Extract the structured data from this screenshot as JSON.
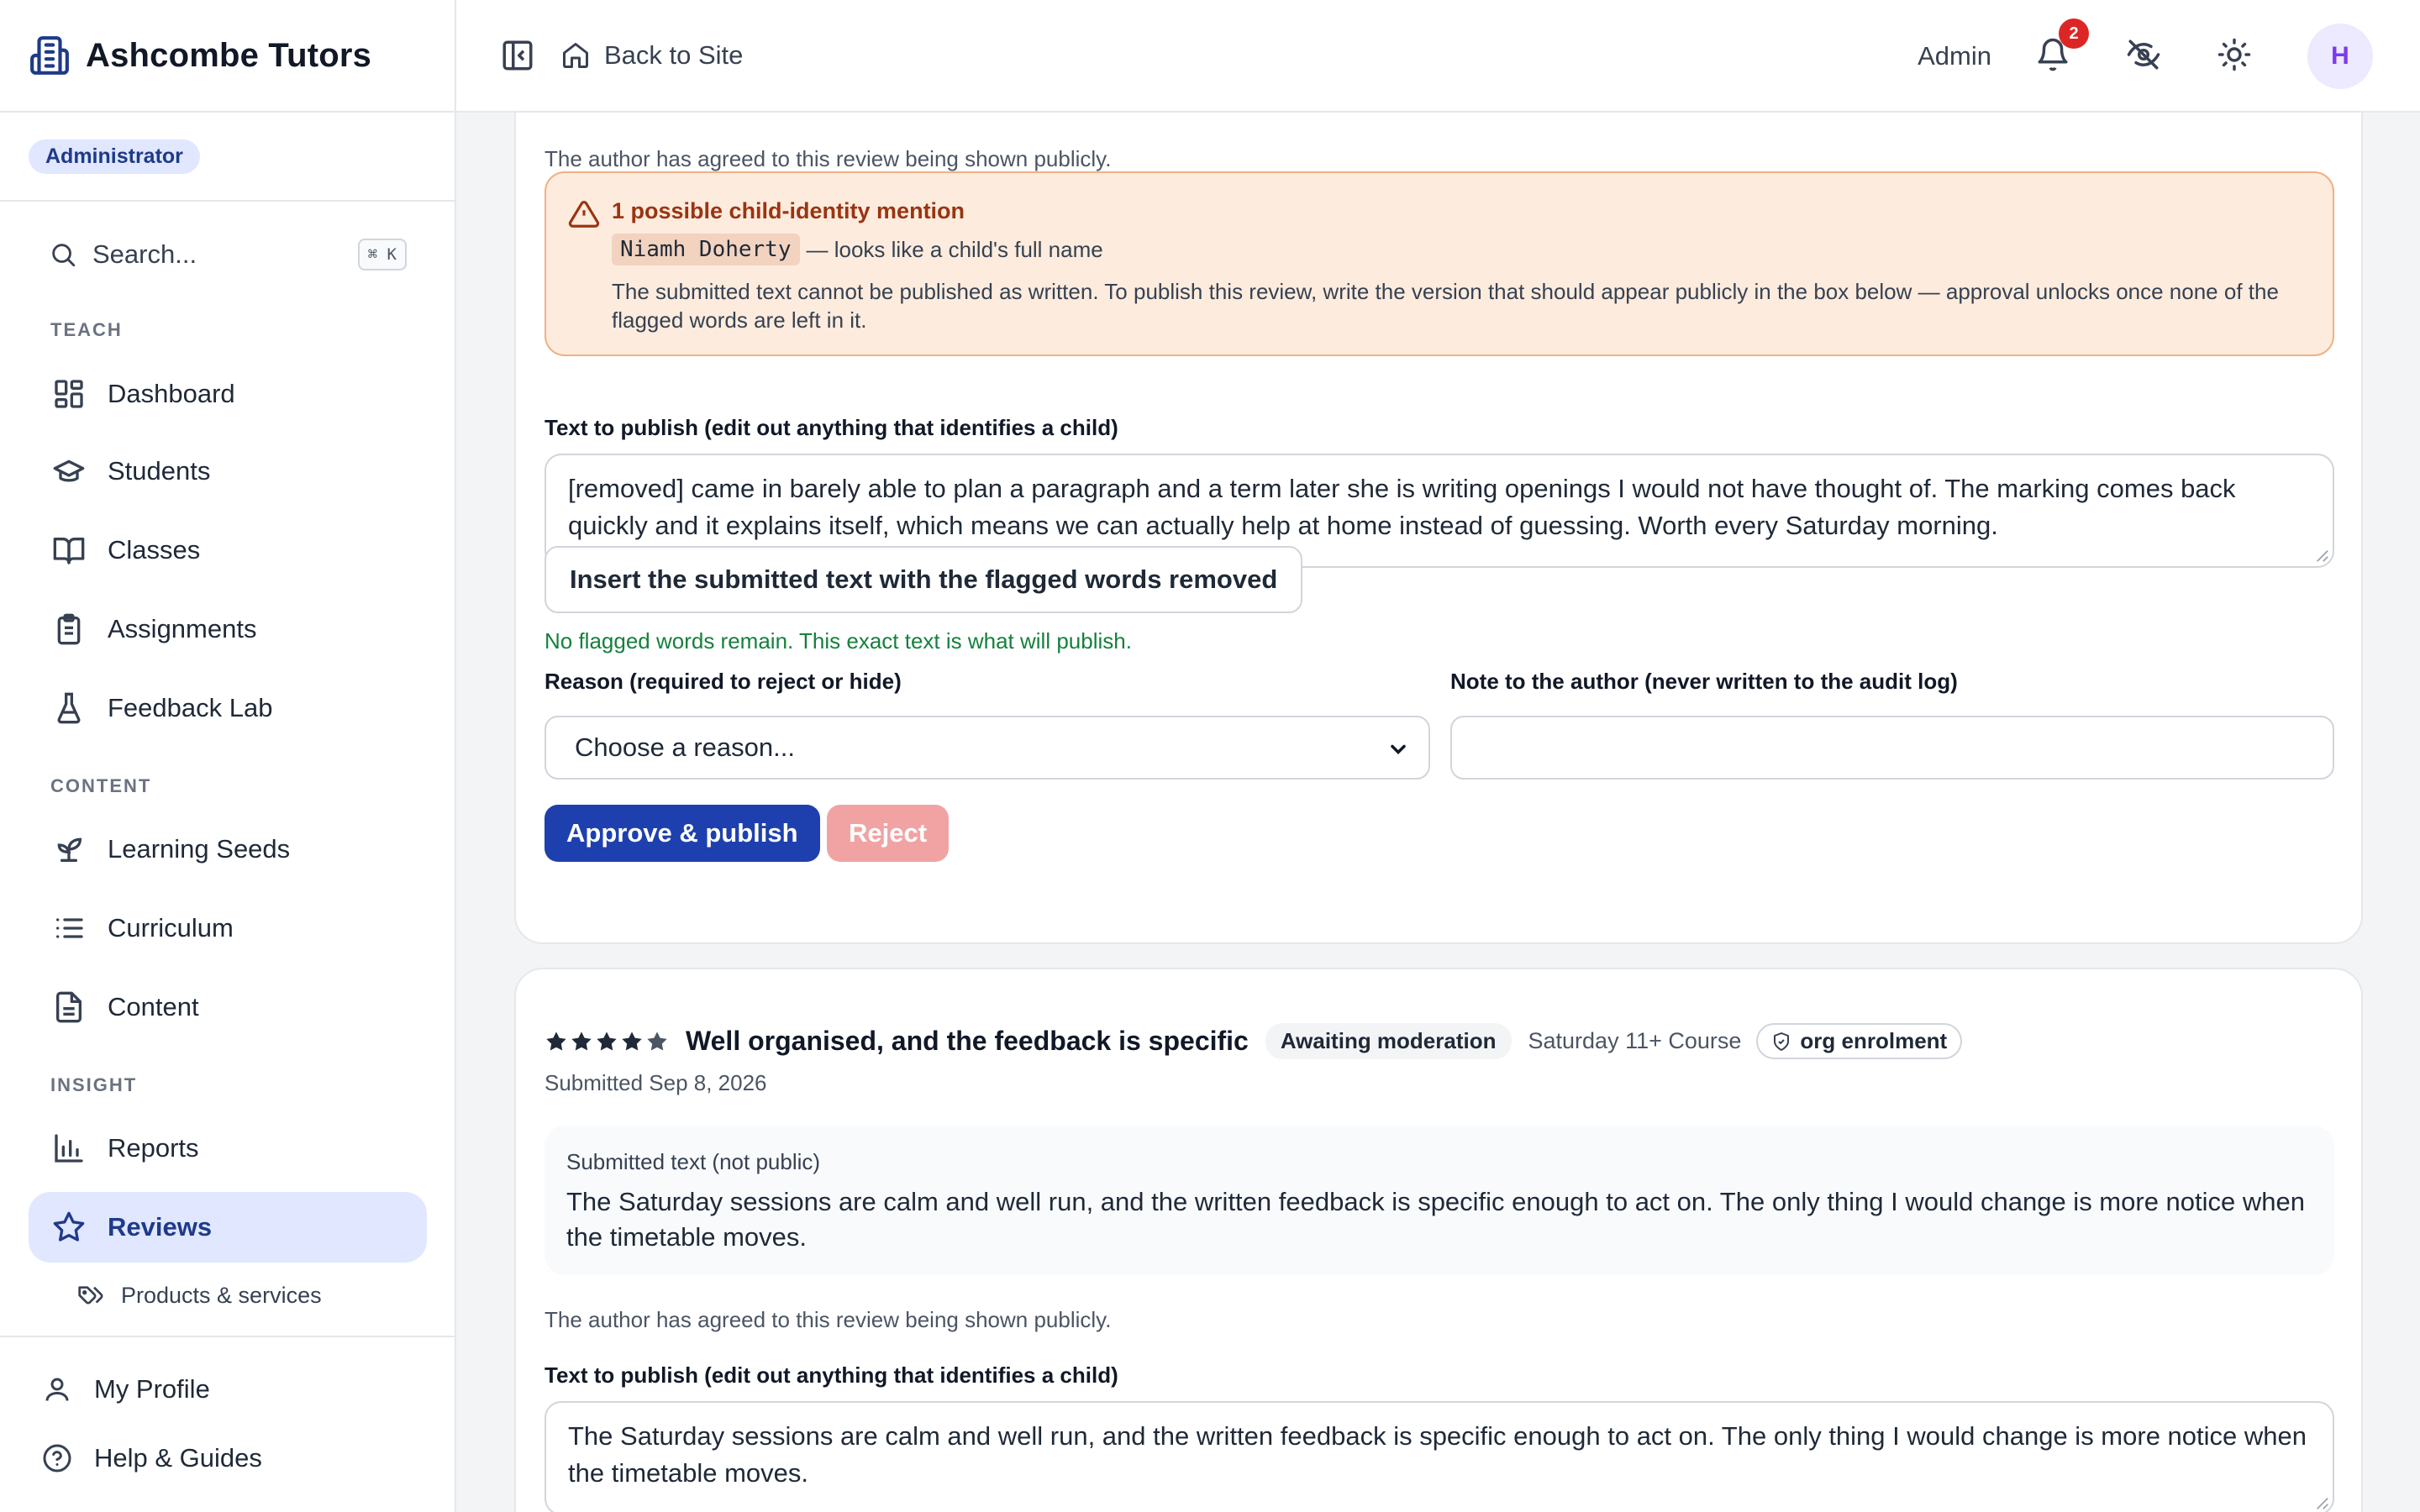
{
  "app": {
    "title": "Ashcombe Tutors",
    "role_badge": "Administrator"
  },
  "search": {
    "label": "Search...",
    "shortcut": "⌘ K"
  },
  "sidebar": {
    "sections": {
      "teach": "TEACH",
      "content": "CONTENT",
      "insight": "INSIGHT"
    },
    "items": [
      {
        "label": "Dashboard",
        "icon": "dashboard-icon"
      },
      {
        "label": "Students",
        "icon": "graduation-cap-icon"
      },
      {
        "label": "Classes",
        "icon": "book-open-icon"
      },
      {
        "label": "Assignments",
        "icon": "clipboard-icon"
      },
      {
        "label": "Feedback Lab",
        "icon": "flask-icon"
      },
      {
        "label": "Learning Seeds",
        "icon": "sprout-icon"
      },
      {
        "label": "Curriculum",
        "icon": "list-icon"
      },
      {
        "label": "Content",
        "icon": "document-icon"
      },
      {
        "label": "Reports",
        "icon": "bar-chart-icon"
      },
      {
        "label": "Reviews",
        "icon": "star-icon",
        "active": true
      }
    ],
    "sub_item": {
      "label": "Products & services",
      "icon": "tags-icon"
    },
    "bottom": [
      {
        "label": "My Profile",
        "icon": "user-icon"
      },
      {
        "label": "Help & Guides",
        "icon": "help-circle-icon"
      }
    ]
  },
  "topbar": {
    "back_label": "Back to Site",
    "admin_label": "Admin",
    "notification_count": "2",
    "avatar_initial": "H"
  },
  "review1": {
    "consent_note": "The author has agreed to this review being shown publicly.",
    "warning": {
      "title": "1 possible child-identity mention",
      "flagged_name": "Niamh Doherty",
      "flag_note": "— looks like a child's full name",
      "body": "The submitted text cannot be published as written. To publish this review, write the version that should appear publicly in the box below — approval unlocks once none of the flagged words are left in it."
    },
    "publish_label": "Text to publish (edit out anything that identifies a child)",
    "publish_text": "[removed] came in barely able to plan a paragraph and a term later she is writing openings I would not have thought of. The marking comes back quickly and it explains itself, which means we can actually help at home instead of guessing. Worth every Saturday morning.",
    "insert_button": "Insert the submitted text with the flagged words removed",
    "ok_note": "No flagged words remain. This exact text is what will publish.",
    "reason_label": "Reason (required to reject or hide)",
    "reason_value": "Choose a reason...",
    "author_note_label": "Note to the author (never written to the audit log)",
    "author_note_value": "",
    "approve_button": "Approve & publish",
    "reject_button": "Reject"
  },
  "review2": {
    "rating": 4,
    "rating_max": 5,
    "title": "Well organised, and the feedback is specific",
    "status": "Awaiting moderation",
    "course": "Saturday 11+ Course",
    "org_badge": "org enrolment",
    "submitted_date": "Submitted Sep 8, 2026",
    "submitted_label": "Submitted text (not public)",
    "submitted_text": "The Saturday sessions are calm and well run, and the written feedback is specific enough to act on. The only thing I would change is more notice when the timetable moves.",
    "consent_note": "The author has agreed to this review being shown publicly.",
    "publish_label": "Text to publish (edit out anything that identifies a child)",
    "publish_text": "The Saturday sessions are calm and well run, and the written feedback is specific enough to act on. The only thing I would change is more notice when the timetable moves."
  },
  "colors": {
    "accent": "#1e40af",
    "active_bg": "#e0e7ff",
    "warning_bg": "#fdecde",
    "success": "#15803d",
    "danger_disabled": "#f1a3a3"
  }
}
